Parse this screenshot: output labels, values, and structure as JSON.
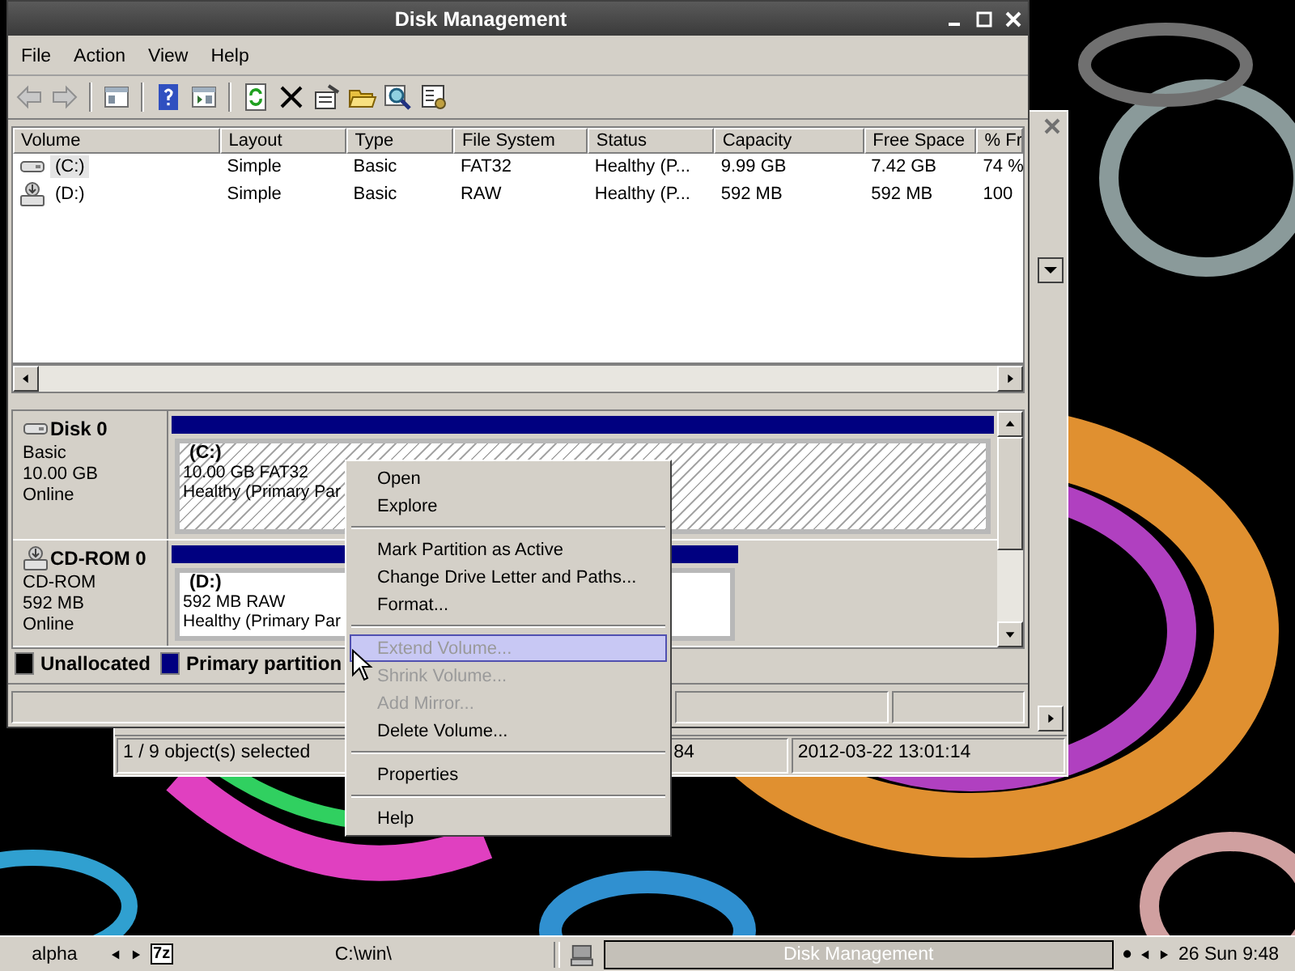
{
  "back_window": {
    "status_bar": [
      "1 / 9 object(s) selected",
      "84",
      "2012-03-22 13:01:14"
    ]
  },
  "window": {
    "title": "Disk Management"
  },
  "menu": [
    "File",
    "Action",
    "View",
    "Help"
  ],
  "volumes": {
    "columns": [
      "Volume",
      "Layout",
      "Type",
      "File System",
      "Status",
      "Capacity",
      "Free Space",
      "% Fr"
    ],
    "rows": [
      {
        "kind": "disk",
        "selected": true,
        "cells": [
          "(C:)",
          "Simple",
          "Basic",
          "FAT32",
          "Healthy (P...",
          "9.99 GB",
          "7.42 GB",
          "74 %"
        ]
      },
      {
        "kind": "cdrom",
        "selected": false,
        "cells": [
          "(D:)",
          "Simple",
          "Basic",
          "RAW",
          "Healthy (P...",
          "592 MB",
          "592 MB",
          "100"
        ]
      }
    ]
  },
  "disks": [
    {
      "kind": "disk",
      "name": "Disk 0",
      "type": "Basic",
      "size": "10.00 GB",
      "status": "Online",
      "partitions": [
        {
          "label": "(C:)",
          "size": "10.00 GB FAT32",
          "status": "Healthy (Primary Par",
          "selected": true
        }
      ]
    },
    {
      "kind": "cdrom",
      "name": "CD-ROM 0",
      "type": "CD-ROM",
      "size": "592 MB",
      "status": "Online",
      "partitions": [
        {
          "label": "(D:)",
          "size": "592 MB RAW",
          "status": "Healthy (Primary Par",
          "selected": false
        }
      ]
    }
  ],
  "legend": [
    {
      "label": "Unallocated",
      "color": "#000000"
    },
    {
      "label": "Primary partition",
      "color": "#000080"
    }
  ],
  "context_menu": {
    "items": [
      {
        "kind": "item",
        "label": "Open",
        "disabled": false,
        "selected": false
      },
      {
        "kind": "item",
        "label": "Explore",
        "disabled": false,
        "selected": false
      },
      {
        "kind": "separator"
      },
      {
        "kind": "item",
        "label": "Mark Partition as Active",
        "disabled": false,
        "selected": false
      },
      {
        "kind": "item",
        "label": "Change Drive Letter and Paths...",
        "disabled": false,
        "selected": false
      },
      {
        "kind": "item",
        "label": "Format...",
        "disabled": false,
        "selected": false
      },
      {
        "kind": "separator"
      },
      {
        "kind": "item",
        "label": "Extend Volume...",
        "disabled": true,
        "selected": true
      },
      {
        "kind": "item",
        "label": "Shrink Volume...",
        "disabled": true,
        "selected": false
      },
      {
        "kind": "item",
        "label": "Add Mirror...",
        "disabled": true,
        "selected": false
      },
      {
        "kind": "item",
        "label": "Delete Volume...",
        "disabled": false,
        "selected": false
      },
      {
        "kind": "separator"
      },
      {
        "kind": "item",
        "label": "Properties",
        "disabled": false,
        "selected": false
      },
      {
        "kind": "separator"
      },
      {
        "kind": "item",
        "label": "Help",
        "disabled": false,
        "selected": false
      }
    ]
  },
  "taskbar": {
    "workspace": "alpha",
    "launcher": "7z",
    "path": "C:\\win\\",
    "tasks": [
      {
        "label": "Disk Management",
        "selected": true
      }
    ],
    "clock": "26 Sun 9:48"
  }
}
